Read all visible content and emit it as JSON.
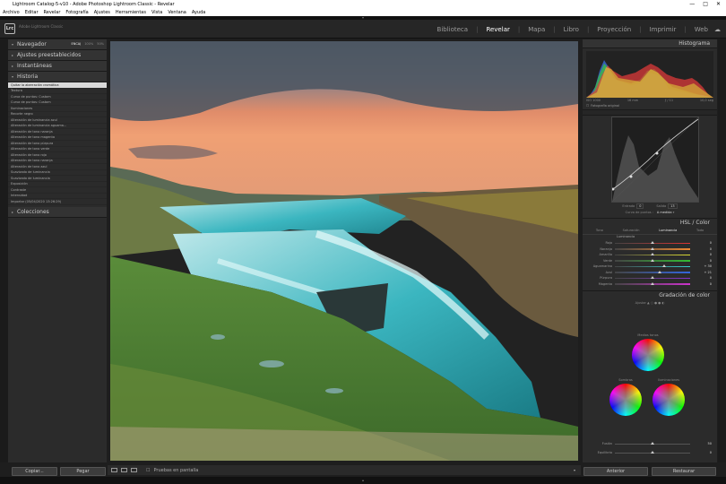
{
  "window": {
    "title": "Lightroom Catalog-5-v10 - Adobe Photoshop Lightroom Classic - Revelar",
    "controls": [
      "—",
      "□",
      "✕"
    ]
  },
  "menu": [
    "Archivo",
    "Editar",
    "Revelar",
    "Fotografía",
    "Ajustes",
    "Herramientas",
    "Vista",
    "Ventana",
    "Ayuda"
  ],
  "identity": {
    "logo": "Lrc",
    "app_name": "Adobe Lightroom Classic"
  },
  "modules": [
    {
      "label": "Biblioteca",
      "active": false
    },
    {
      "label": "Revelar",
      "active": true
    },
    {
      "label": "Mapa",
      "active": false
    },
    {
      "label": "Libro",
      "active": false
    },
    {
      "label": "Proyección",
      "active": false
    },
    {
      "label": "Imprimir",
      "active": false
    },
    {
      "label": "Web",
      "active": false
    }
  ],
  "left_panel": {
    "navigator": {
      "label": "Navegador",
      "zoom": [
        "ENCAJ",
        "100%",
        "50%"
      ],
      "selected_zoom": "ENCAJ"
    },
    "presets": {
      "label": "Ajustes preestablecidos"
    },
    "snapshots": {
      "label": "Instantáneas"
    },
    "history": {
      "label": "Historia",
      "items": [
        {
          "name": "Quitar la aberración cromática",
          "v1": "",
          "v2": "",
          "selected": true
        },
        {
          "name": "Textura",
          "v1": "",
          "v2": "",
          "selected": false
        },
        {
          "name": "Curva de puntos: Custom",
          "v1": "",
          "v2": "",
          "selected": false
        },
        {
          "name": "Curva de puntos: Custom",
          "v1": "",
          "v2": "",
          "selected": false
        },
        {
          "name": "Iluminaciones",
          "v1": "",
          "v2": "",
          "selected": false
        },
        {
          "name": "Recorte negro",
          "v1": "",
          "v2": "",
          "selected": false
        },
        {
          "name": "Alteración de luminancia azul",
          "v1": "",
          "v2": "",
          "selected": false
        },
        {
          "name": "Alteración de luminancia aguama...",
          "v1": "",
          "v2": "",
          "selected": false
        },
        {
          "name": "Alteración de tono naranja",
          "v1": "",
          "v2": "",
          "selected": false
        },
        {
          "name": "Alteración de tono magenta",
          "v1": "",
          "v2": "",
          "selected": false
        },
        {
          "name": "Alteración de tono púrpura",
          "v1": "",
          "v2": "",
          "selected": false
        },
        {
          "name": "Alteración de tono verde",
          "v1": "",
          "v2": "",
          "selected": false
        },
        {
          "name": "Alteración de tono rojo",
          "v1": "",
          "v2": "",
          "selected": false
        },
        {
          "name": "Alteración de tono naranja",
          "v1": "",
          "v2": "",
          "selected": false
        },
        {
          "name": "Alteración de tono azul",
          "v1": "",
          "v2": "",
          "selected": false
        },
        {
          "name": "Suavizado de luminancia",
          "v1": "",
          "v2": "",
          "selected": false
        },
        {
          "name": "Suavizado de luminancia",
          "v1": "",
          "v2": "",
          "selected": false
        },
        {
          "name": "Exposición",
          "v1": "",
          "v2": "",
          "selected": false
        },
        {
          "name": "Contraste",
          "v1": "",
          "v2": "",
          "selected": false
        },
        {
          "name": "Intensidad",
          "v1": "",
          "v2": "",
          "selected": false
        },
        {
          "name": "Importar (05/04/2020 13:26:29)",
          "v1": "",
          "v2": "",
          "selected": false
        }
      ]
    },
    "collections": {
      "label": "Colecciones"
    },
    "copy_button": "Copiar...",
    "paste_button": "Pegar"
  },
  "toolbar": {
    "proof_label": "Pruebas en pantalla"
  },
  "right_panel": {
    "histogram": {
      "label": "Histograma",
      "iso": "ISO 1000",
      "focal": "16 mm",
      "aperture": "ƒ / 11",
      "shutter": "10,0 seg",
      "original_label": "Fotografía original"
    },
    "curve": {
      "input_label": "Entrada",
      "input_value": "0",
      "output_label": "Salida",
      "output_value": "13",
      "point_curve_label": "Curva de puntos :",
      "point_curve_value": "A medida"
    },
    "hsl": {
      "label": "HSL / Color",
      "tabs": [
        "Tono",
        "Saturación",
        "Luminancia",
        "Todo"
      ],
      "active_tab": "Luminancia",
      "sub": "Luminancia",
      "sliders": [
        {
          "label": "Rojo",
          "value": "0",
          "pos": 0.5,
          "color": "#d33"
        },
        {
          "label": "Naranja",
          "value": "0",
          "pos": 0.5,
          "color": "#e83"
        },
        {
          "label": "Amarillo",
          "value": "0",
          "pos": 0.5,
          "color": "#dd3"
        },
        {
          "label": "Verde",
          "value": "0",
          "pos": 0.5,
          "color": "#3b3"
        },
        {
          "label": "Aguamarina",
          "value": "+ 30",
          "pos": 0.65,
          "color": "#3cc"
        },
        {
          "label": "Azul",
          "value": "+ 21",
          "pos": 0.6,
          "color": "#36d"
        },
        {
          "label": "Púrpura",
          "value": "0",
          "pos": 0.5,
          "color": "#83c"
        },
        {
          "label": "Magenta",
          "value": "0",
          "pos": 0.5,
          "color": "#c3c"
        }
      ]
    },
    "grading": {
      "label": "Gradación de color",
      "adjust_label": "Ajustar",
      "midtones_label": "Medios tonos",
      "shadows_label": "Sombras",
      "highlights_label": "Iluminaciones",
      "blend_label": "Fusión",
      "blend_value": "50",
      "balance_label": "Equilibrio",
      "balance_value": "0"
    },
    "prev_button": "Anterior",
    "reset_button": "Restaurar"
  }
}
